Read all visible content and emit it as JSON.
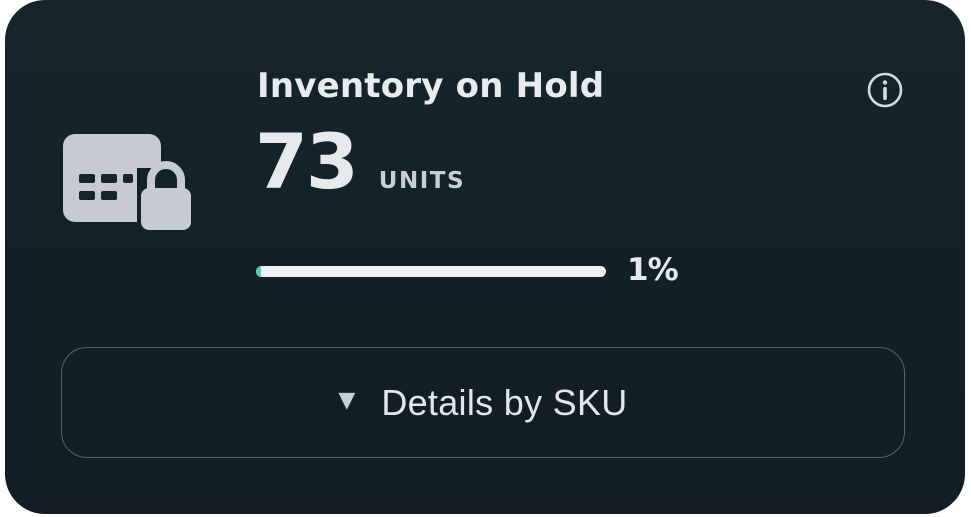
{
  "card": {
    "title": "Inventory on Hold",
    "value": "73",
    "unit": "UNITS",
    "progress_fraction": 0.01,
    "progress_label": "1%",
    "details_button_label": "Details by SKU",
    "details_caret": "▼"
  },
  "icons": {
    "main": "grid-lock-icon",
    "info": "info-icon"
  },
  "colors": {
    "background": "#14222a",
    "text": "#e6eaed",
    "progress_track": "#eef0f1",
    "progress_fill": "#4fd1b9",
    "border": "#56636b"
  }
}
